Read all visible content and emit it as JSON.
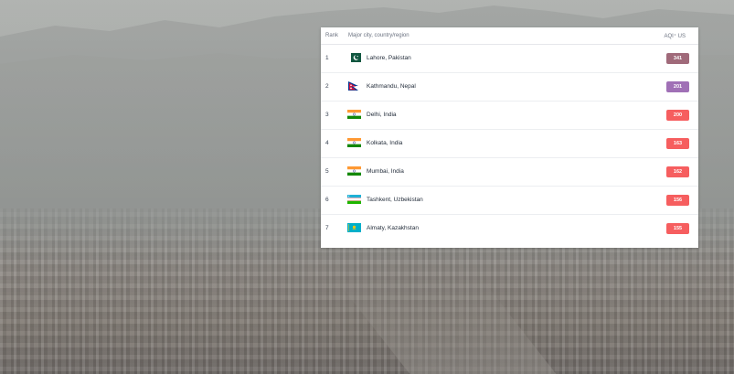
{
  "table": {
    "headers": {
      "rank": "Rank",
      "city": "Major city, country/region",
      "aqi": "AQI⁺ US"
    },
    "rows": [
      {
        "rank": "1",
        "city": "Lahore, Pakistan",
        "aqi": "341",
        "flag": "pakistan-flag",
        "color": "#a06a7a"
      },
      {
        "rank": "2",
        "city": "Kathmandu, Nepal",
        "aqi": "201",
        "flag": "nepal-flag",
        "color": "#a070b6"
      },
      {
        "rank": "3",
        "city": "Delhi, India",
        "aqi": "200",
        "flag": "india-flag",
        "color": "#f65e5f"
      },
      {
        "rank": "4",
        "city": "Kolkata, India",
        "aqi": "163",
        "flag": "india-flag",
        "color": "#f65e5f"
      },
      {
        "rank": "5",
        "city": "Mumbai, India",
        "aqi": "162",
        "flag": "india-flag",
        "color": "#f65e5f"
      },
      {
        "rank": "6",
        "city": "Tashkent, Uzbekistan",
        "aqi": "156",
        "flag": "uzbekistan-flag",
        "color": "#f65e5f"
      },
      {
        "rank": "7",
        "city": "Almaty, Kazakhstan",
        "aqi": "155",
        "flag": "kazakhstan-flag",
        "color": "#f65e5f"
      }
    ]
  }
}
